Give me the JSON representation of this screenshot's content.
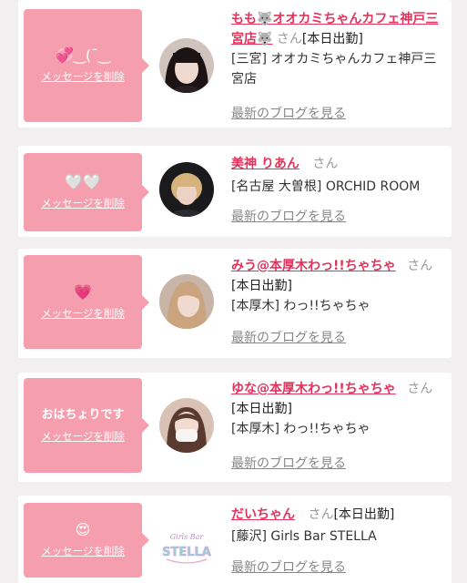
{
  "items": [
    {
      "message": "💞‿(¯‿",
      "delete_label": "メッセージを削除",
      "name": "もも🐺オオカミちゃんカフェ神戸三宮店🐺",
      "suffix": "さん",
      "status": "[本日出勤]",
      "shop": "[三宮] オオカミちゃんカフェ神戸三宮店",
      "blog_label": "最新のブログを見る"
    },
    {
      "message": "🤍🤍",
      "delete_label": "メッセージを削除",
      "name": "美神 りあん",
      "suffix": "さん",
      "status": "",
      "shop": "[名古屋 大曽根] ORCHID ROOM",
      "blog_label": "最新のブログを見る"
    },
    {
      "message": "💗",
      "delete_label": "メッセージを削除",
      "name": "みう@本厚木わっ!!ちゃちゃ",
      "suffix": "さん",
      "status": "[本日出勤]",
      "shop": "[本厚木] わっ!!ちゃちゃ",
      "blog_label": "最新のブログを見る"
    },
    {
      "message": "おはちょりです",
      "delete_label": "メッセージを削除",
      "name": "ゆな@本厚木わっ!!ちゃちゃ",
      "suffix": "さん",
      "status": "[本日出勤]",
      "shop": "[本厚木] わっ!!ちゃちゃ",
      "blog_label": "最新のブログを見る"
    },
    {
      "message": "😍",
      "delete_label": "メッセージを削除",
      "name": "だいちゃん",
      "suffix": "さん",
      "status": "[本日出勤]",
      "shop": "[藤沢] Girls Bar STELLA",
      "blog_label": "最新のブログを見る"
    }
  ],
  "logo_text": "STELLA"
}
